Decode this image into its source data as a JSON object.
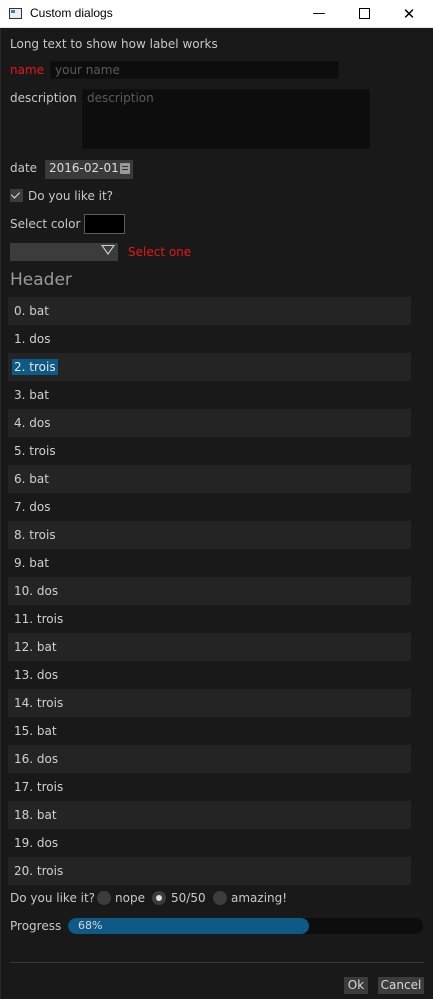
{
  "window": {
    "title": "Custom dialogs",
    "minimize": "—",
    "close": "✕"
  },
  "form": {
    "long_text": "Long text to show how label works",
    "name_label": "name",
    "name_placeholder": "your name",
    "description_label": "description",
    "description_placeholder": "description",
    "date_label": "date",
    "date_value": "2016-02-01",
    "like_checkbox_label": "Do you like it?",
    "like_checked": true,
    "color_label": "Select color",
    "color_value": "#000000",
    "combo_value": "",
    "combo_hint": "Select one",
    "error_color": "#e81818"
  },
  "list": {
    "header": "Header",
    "selected_index": 2,
    "items": [
      "0. bat",
      "1. dos",
      "2. trois",
      "3. bat",
      "4. dos",
      "5. trois",
      "6. bat",
      "7. dos",
      "8. trois",
      "9. bat",
      "10. dos",
      "11. trois",
      "12. bat",
      "13. dos",
      "14. trois",
      "15. bat",
      "16. dos",
      "17. trois",
      "18. bat",
      "19. dos",
      "20. trois"
    ]
  },
  "radio_group": {
    "label": "Do you like it?",
    "options": [
      "nope",
      "50/50",
      "amazing!"
    ],
    "selected": "50/50"
  },
  "progress": {
    "label": "Progress",
    "value": 0.68,
    "text": "68%"
  },
  "buttons": {
    "ok": "Ok",
    "cancel": "Cancel"
  },
  "colors": {
    "accent": "#0e5a86",
    "background": "#191919"
  }
}
